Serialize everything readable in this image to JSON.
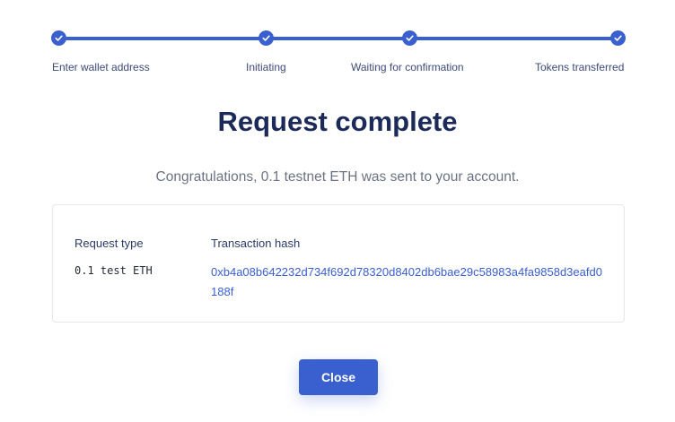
{
  "steps": [
    {
      "label": "Enter wallet address",
      "status": "complete"
    },
    {
      "label": "Initiating",
      "status": "complete"
    },
    {
      "label": "Waiting for confirmation",
      "status": "complete"
    },
    {
      "label": "Tokens transferred",
      "status": "complete"
    }
  ],
  "title": "Request complete",
  "subtitle": "Congratulations, 0.1 testnet ETH was sent to your account.",
  "details": {
    "request_type_label": "Request type",
    "request_type_value": "0.1 test ETH",
    "tx_hash_label": "Transaction hash",
    "tx_hash_value": "0xb4a08b642232d734f692d78320d8402db6bae29c58983a4fa9858d3eafd0188f"
  },
  "close_label": "Close",
  "colors": {
    "accent": "#3a5fcf",
    "title": "#1c2a5a",
    "muted": "#6b7280"
  }
}
